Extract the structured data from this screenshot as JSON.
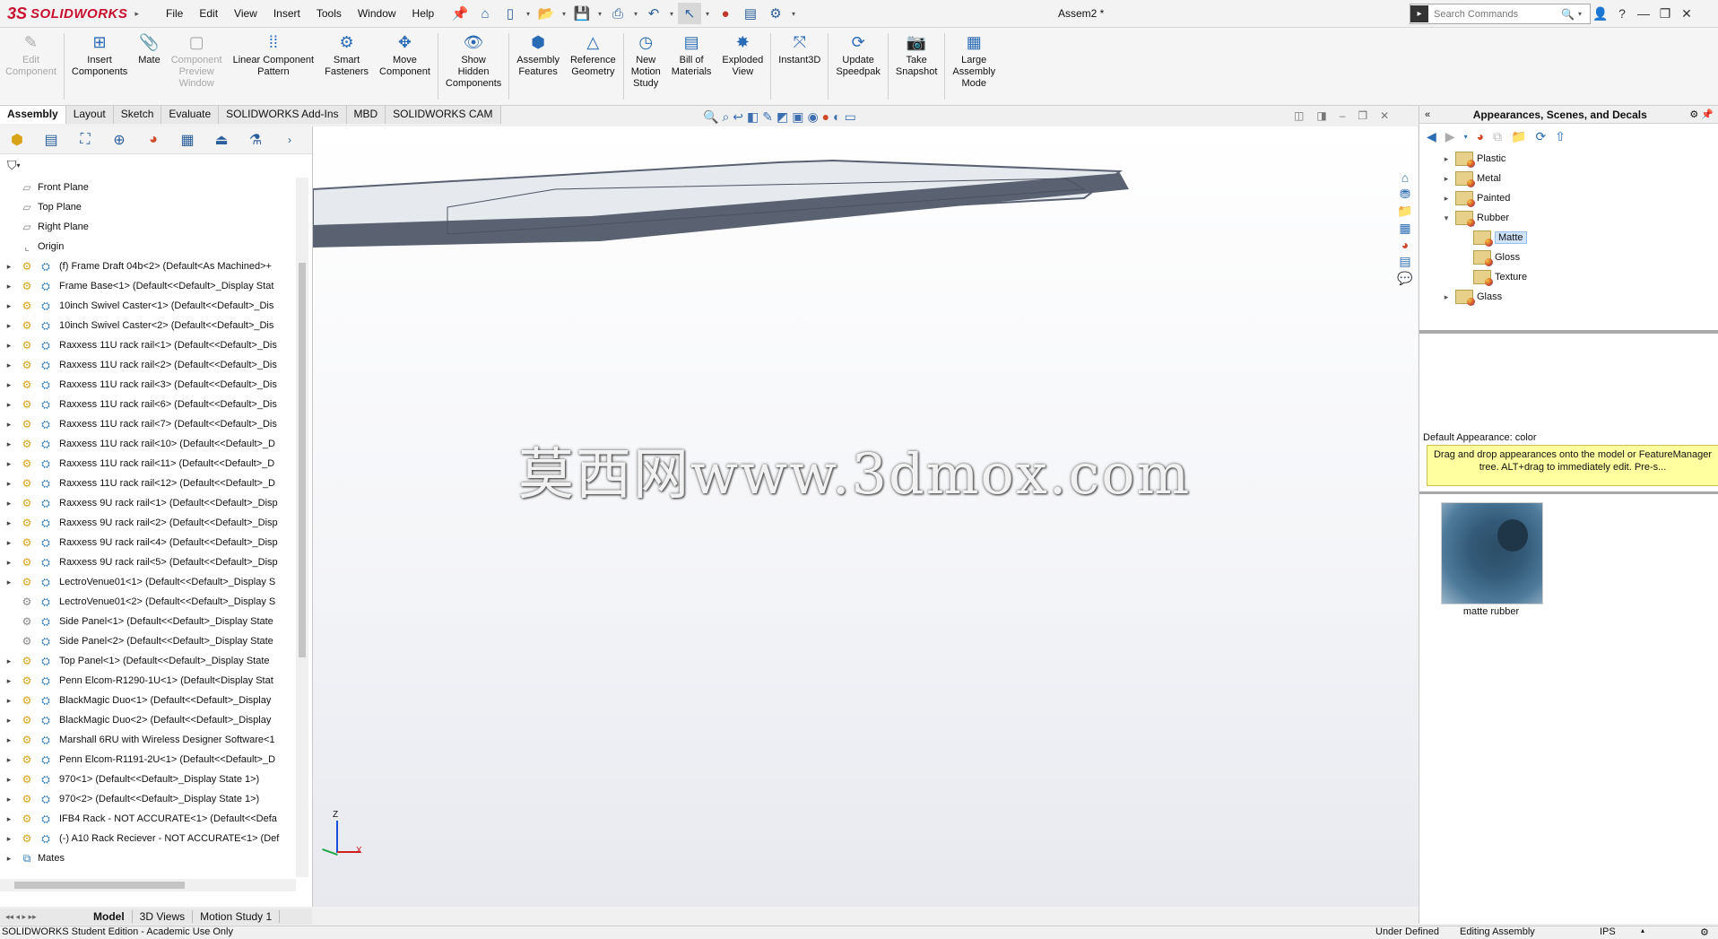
{
  "app": {
    "brand_prefix": "3S",
    "brand": "SOLIDWORKS",
    "document_title": "Assem2 *"
  },
  "menu": [
    "File",
    "Edit",
    "View",
    "Insert",
    "Tools",
    "Window",
    "Help"
  ],
  "search": {
    "placeholder": "Search Commands"
  },
  "command_manager": [
    {
      "label": "Edit\nComponent",
      "icon": "edit-component-icon",
      "disabled": true
    },
    {
      "label": "Insert\nComponents",
      "icon": "insert-components-icon",
      "disabled": false
    },
    {
      "label": "Mate",
      "icon": "mate-icon",
      "disabled": false
    },
    {
      "label": "Component\nPreview\nWindow",
      "icon": "component-preview-icon",
      "disabled": true
    },
    {
      "label": "Linear Component\nPattern",
      "icon": "linear-pattern-icon",
      "disabled": false
    },
    {
      "label": "Smart\nFasteners",
      "icon": "smart-fasteners-icon",
      "disabled": false
    },
    {
      "label": "Move\nComponent",
      "icon": "move-component-icon",
      "disabled": false
    },
    {
      "label": "Show\nHidden\nComponents",
      "icon": "show-hidden-icon",
      "disabled": false
    },
    {
      "label": "Assembly\nFeatures",
      "icon": "assembly-features-icon",
      "disabled": false
    },
    {
      "label": "Reference\nGeometry",
      "icon": "reference-geometry-icon",
      "disabled": false
    },
    {
      "label": "New\nMotion\nStudy",
      "icon": "motion-study-icon",
      "disabled": false
    },
    {
      "label": "Bill of\nMaterials",
      "icon": "bom-icon",
      "disabled": false
    },
    {
      "label": "Exploded\nView",
      "icon": "exploded-view-icon",
      "disabled": false
    },
    {
      "label": "Instant3D",
      "icon": "instant3d-icon",
      "disabled": false
    },
    {
      "label": "Update\nSpeedpak",
      "icon": "speedpak-icon",
      "disabled": false
    },
    {
      "label": "Take\nSnapshot",
      "icon": "snapshot-icon",
      "disabled": false
    },
    {
      "label": "Large\nAssembly\nMode",
      "icon": "large-assembly-icon",
      "disabled": false
    }
  ],
  "cm_tabs": [
    "Assembly",
    "Layout",
    "Sketch",
    "Evaluate",
    "SOLIDWORKS Add-Ins",
    "MBD",
    "SOLIDWORKS CAM"
  ],
  "tree": [
    {
      "label": "Front Plane",
      "type": "plane",
      "expand": false
    },
    {
      "label": "Top Plane",
      "type": "plane",
      "expand": false
    },
    {
      "label": "Right Plane",
      "type": "plane",
      "expand": false
    },
    {
      "label": "Origin",
      "type": "origin",
      "expand": false
    },
    {
      "label": "(f) Frame Draft 04b<2> (Default<As Machined>+",
      "type": "comp",
      "expand": true
    },
    {
      "label": "Frame Base<1> (Default<<Default>_Display Stat",
      "type": "comp",
      "expand": true
    },
    {
      "label": "10inch Swivel Caster<1> (Default<<Default>_Dis",
      "type": "comp",
      "expand": true
    },
    {
      "label": "10inch Swivel Caster<2> (Default<<Default>_Dis",
      "type": "comp",
      "expand": true
    },
    {
      "label": "Raxxess 11U rack rail<1> (Default<<Default>_Dis",
      "type": "comp",
      "expand": true
    },
    {
      "label": "Raxxess 11U rack rail<2> (Default<<Default>_Dis",
      "type": "comp",
      "expand": true
    },
    {
      "label": "Raxxess 11U rack rail<3> (Default<<Default>_Dis",
      "type": "comp",
      "expand": true
    },
    {
      "label": "Raxxess 11U rack rail<6> (Default<<Default>_Dis",
      "type": "comp",
      "expand": true
    },
    {
      "label": "Raxxess 11U rack rail<7> (Default<<Default>_Dis",
      "type": "comp",
      "expand": true
    },
    {
      "label": "Raxxess 11U rack rail<10> (Default<<Default>_D",
      "type": "comp",
      "expand": true
    },
    {
      "label": "Raxxess 11U rack rail<11> (Default<<Default>_D",
      "type": "comp",
      "expand": true
    },
    {
      "label": "Raxxess 11U rack rail<12> (Default<<Default>_D",
      "type": "comp",
      "expand": true
    },
    {
      "label": "Raxxess 9U rack rail<1> (Default<<Default>_Disp",
      "type": "comp",
      "expand": true
    },
    {
      "label": "Raxxess 9U rack rail<2> (Default<<Default>_Disp",
      "type": "comp",
      "expand": true
    },
    {
      "label": "Raxxess 9U rack rail<4> (Default<<Default>_Disp",
      "type": "comp",
      "expand": true
    },
    {
      "label": "Raxxess 9U rack rail<5> (Default<<Default>_Disp",
      "type": "comp",
      "expand": true
    },
    {
      "label": "LectroVenue01<1> (Default<<Default>_Display S",
      "type": "comp",
      "expand": true
    },
    {
      "label": "LectroVenue01<2> (Default<<Default>_Display S",
      "type": "comp-light",
      "expand": false
    },
    {
      "label": "Side Panel<1> (Default<<Default>_Display State",
      "type": "comp-light",
      "expand": false
    },
    {
      "label": "Side Panel<2> (Default<<Default>_Display State",
      "type": "comp-light",
      "expand": false
    },
    {
      "label": "Top Panel<1> (Default<<Default>_Display State",
      "type": "comp",
      "expand": true
    },
    {
      "label": "Penn Elcom-R1290-1U<1> (Default<Display Stat",
      "type": "comp",
      "expand": true
    },
    {
      "label": "BlackMagic Duo<1> (Default<<Default>_Display",
      "type": "comp",
      "expand": true
    },
    {
      "label": "BlackMagic Duo<2> (Default<<Default>_Display",
      "type": "comp",
      "expand": true
    },
    {
      "label": "Marshall 6RU with Wireless Designer Software<1",
      "type": "comp",
      "expand": true
    },
    {
      "label": "Penn Elcom-R1191-2U<1> (Default<<Default>_D",
      "type": "comp",
      "expand": true
    },
    {
      "label": "970<1> (Default<<Default>_Display State 1>)",
      "type": "comp",
      "expand": true
    },
    {
      "label": "970<2> (Default<<Default>_Display State 1>)",
      "type": "comp",
      "expand": true
    },
    {
      "label": "IFB4 Rack - NOT ACCURATE<1> (Default<<Defa",
      "type": "comp",
      "expand": true
    },
    {
      "label": "(-) A10 Rack Reciever - NOT ACCURATE<1> (Def",
      "type": "comp",
      "expand": true
    },
    {
      "label": "Mates",
      "type": "mates",
      "expand": true
    }
  ],
  "bottom_tabs": [
    "Model",
    "3D Views",
    "Motion Study 1"
  ],
  "status": {
    "left": "SOLIDWORKS Student Edition - Academic Use Only",
    "defined": "Under Defined",
    "mode": "Editing Assembly",
    "units": "IPS"
  },
  "task_pane": {
    "title": "Appearances, Scenes, and Decals",
    "tree": [
      {
        "label": "Plastic",
        "expand": "closed",
        "level": 0,
        "selected": false
      },
      {
        "label": "Metal",
        "expand": "closed",
        "level": 0,
        "selected": false
      },
      {
        "label": "Painted",
        "expand": "closed",
        "level": 0,
        "selected": false
      },
      {
        "label": "Rubber",
        "expand": "open",
        "level": 0,
        "selected": false
      },
      {
        "label": "Matte",
        "expand": "none",
        "level": 1,
        "selected": true
      },
      {
        "label": "Gloss",
        "expand": "none",
        "level": 1,
        "selected": false
      },
      {
        "label": "Texture",
        "expand": "none",
        "level": 1,
        "selected": false
      },
      {
        "label": "Glass",
        "expand": "closed",
        "level": 0,
        "selected": false
      }
    ],
    "default_appearance": "Default Appearance: color",
    "help_text": "Drag and drop appearances onto the model or FeatureManager tree.  ALT+drag to immediately edit.  Pre-s...",
    "swatch_label": "matte rubber"
  },
  "triad": {
    "z": "Z",
    "x": "X"
  },
  "watermark": "莫西网www.3dmox.com",
  "colors": {
    "brand": "#c8102e",
    "frame": "#5a6170",
    "selection": "#cfe3fb",
    "help_bg": "#ffff9f"
  }
}
